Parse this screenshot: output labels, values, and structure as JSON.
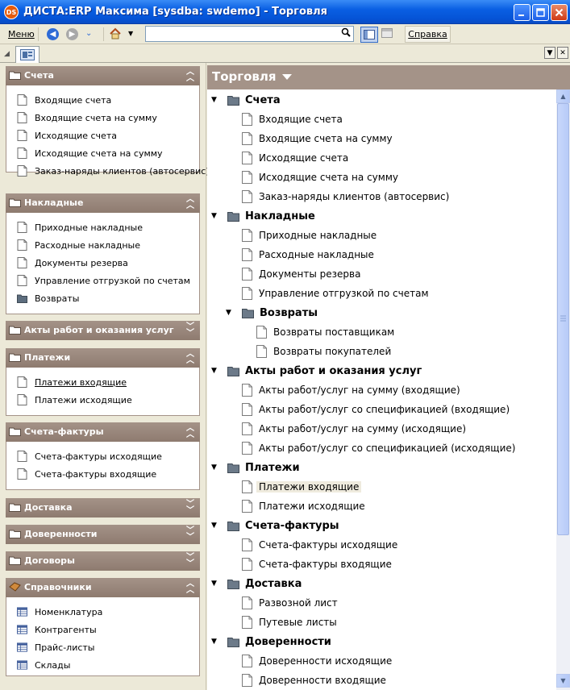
{
  "window": {
    "title": "ДИСТА:ERP Максима [sysdba: swdemo] - Торговля",
    "app_icon_text": "DS"
  },
  "toolbar": {
    "menu_label": "Меню",
    "address_value": "",
    "help_label": "Справка"
  },
  "left_panel": {
    "groups": [
      {
        "title": "Счета",
        "expanded": true,
        "items": [
          "Входящие счета",
          "Входящие счета на сумму",
          "Исходящие счета",
          "Исходящие счета на сумму",
          "Заказ-наряды клиентов (автосервис)"
        ]
      },
      {
        "title": "Накладные",
        "expanded": true,
        "items": [
          "Приходные накладные",
          "Расходные накладные",
          "Документы резерва",
          "Управление отгрузкой по счетам",
          "Возвраты"
        ]
      },
      {
        "title": "Акты работ и оказания услуг",
        "expanded": false,
        "items": []
      },
      {
        "title": "Платежи",
        "expanded": true,
        "items": [
          "Платежи входящие",
          "Платежи исходящие"
        ]
      },
      {
        "title": "Счета-фактуры",
        "expanded": true,
        "items": [
          "Счета-фактуры исходящие",
          "Счета-фактуры входящие"
        ]
      },
      {
        "title": "Доставка",
        "expanded": false,
        "items": []
      },
      {
        "title": "Доверенности",
        "expanded": false,
        "items": []
      },
      {
        "title": "Договоры",
        "expanded": false,
        "items": []
      },
      {
        "title": "Справочники",
        "expanded": true,
        "items": [
          "Номенклатура",
          "Контрагенты",
          "Прайс-листы",
          "Склады"
        ]
      }
    ]
  },
  "right_panel": {
    "title": "Торговля",
    "tree": [
      {
        "label": "Счета",
        "level": 0,
        "kind": "folder"
      },
      {
        "label": "Входящие счета",
        "level": 1,
        "kind": "doc"
      },
      {
        "label": "Входящие счета на сумму",
        "level": 1,
        "kind": "doc"
      },
      {
        "label": "Исходящие счета",
        "level": 1,
        "kind": "doc"
      },
      {
        "label": "Исходящие счета на сумму",
        "level": 1,
        "kind": "doc"
      },
      {
        "label": "Заказ-наряды клиентов (автосервис)",
        "level": 1,
        "kind": "doc"
      },
      {
        "label": "Накладные",
        "level": 0,
        "kind": "folder"
      },
      {
        "label": "Приходные накладные",
        "level": 1,
        "kind": "doc"
      },
      {
        "label": "Расходные накладные",
        "level": 1,
        "kind": "doc"
      },
      {
        "label": "Документы резерва",
        "level": 1,
        "kind": "doc"
      },
      {
        "label": "Управление отгрузкой по счетам",
        "level": 1,
        "kind": "doc"
      },
      {
        "label": "Возвраты",
        "level": 1,
        "kind": "folder"
      },
      {
        "label": "Возвраты поставщикам",
        "level": 2,
        "kind": "doc"
      },
      {
        "label": "Возвраты покупателей",
        "level": 2,
        "kind": "doc"
      },
      {
        "label": "Акты работ и оказания услуг",
        "level": 0,
        "kind": "folder"
      },
      {
        "label": "Акты работ/услуг на сумму (входящие)",
        "level": 1,
        "kind": "doc"
      },
      {
        "label": "Акты работ/услуг со спецификацией (входящие)",
        "level": 1,
        "kind": "doc"
      },
      {
        "label": "Акты работ/услуг на сумму (исходящие)",
        "level": 1,
        "kind": "doc"
      },
      {
        "label": "Акты работ/услуг со спецификацией (исходящие)",
        "level": 1,
        "kind": "doc"
      },
      {
        "label": "Платежи",
        "level": 0,
        "kind": "folder"
      },
      {
        "label": "Платежи входящие",
        "level": 1,
        "kind": "doc",
        "selected": true
      },
      {
        "label": "Платежи исходящие",
        "level": 1,
        "kind": "doc"
      },
      {
        "label": "Счета-фактуры",
        "level": 0,
        "kind": "folder"
      },
      {
        "label": "Счета-фактуры исходящие",
        "level": 1,
        "kind": "doc"
      },
      {
        "label": "Счета-фактуры входящие",
        "level": 1,
        "kind": "doc"
      },
      {
        "label": "Доставка",
        "level": 0,
        "kind": "folder"
      },
      {
        "label": "Развозной лист",
        "level": 1,
        "kind": "doc"
      },
      {
        "label": "Путевые листы",
        "level": 1,
        "kind": "doc"
      },
      {
        "label": "Доверенности",
        "level": 0,
        "kind": "folder"
      },
      {
        "label": "Доверенности исходящие",
        "level": 1,
        "kind": "doc"
      },
      {
        "label": "Доверенности входящие",
        "level": 1,
        "kind": "doc"
      }
    ]
  },
  "colors": {
    "titlebar": "#0a5fe3",
    "group_header": "#a49388",
    "panel_bg": "#ece9d8",
    "selection": "#efebde"
  }
}
